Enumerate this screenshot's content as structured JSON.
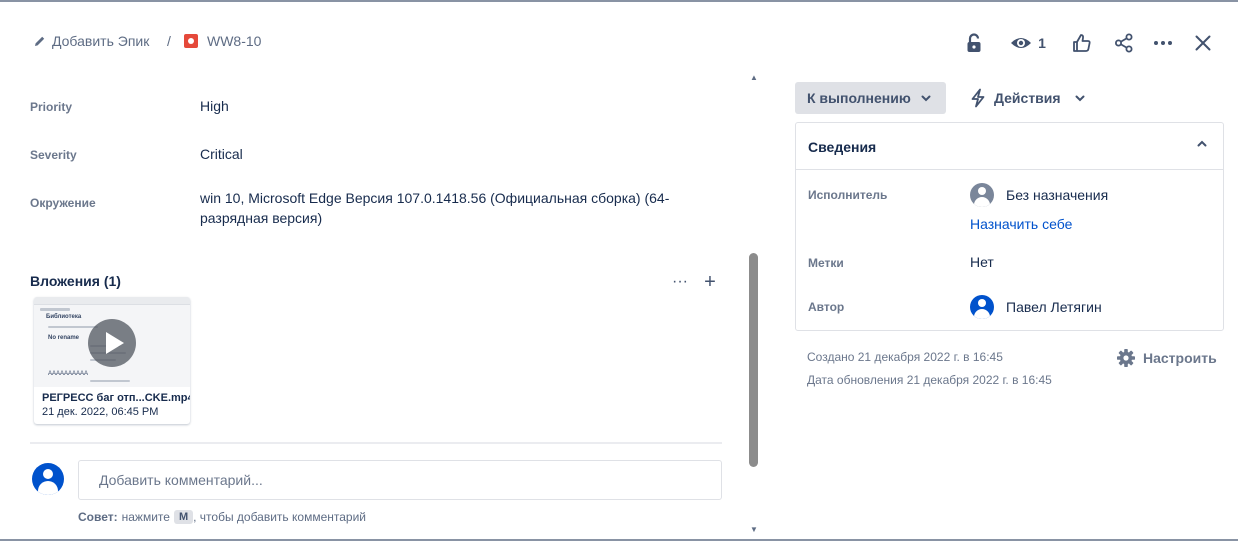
{
  "header": {
    "add_epic": "Добавить Эпик",
    "separator": "/",
    "issue_key": "WW8-10",
    "watch_count": "1"
  },
  "fields": [
    {
      "label": "Priority",
      "value": "High"
    },
    {
      "label": "Severity",
      "value": "Critical"
    },
    {
      "label": "Окружение",
      "value_line1": "win 10, Microsoft Edge Версия 107.0.1418.56 (Официальная сборка) (64-",
      "value_line2": "разрядная версия)"
    }
  ],
  "attachments": {
    "title": "Вложения (1)",
    "more": "···",
    "add": "+",
    "items": [
      {
        "name": "РЕГРЕСС баг отп...CKE.mp4",
        "date": "21 дек. 2022, 06:45 PM",
        "thumb_title": "Библиотека",
        "thumb_row": "No rename",
        "thumb_text": "АААААААААА"
      }
    ]
  },
  "comment": {
    "placeholder": "Добавить комментарий...",
    "tip_prefix": "Совет:",
    "tip_mid": "нажмите",
    "tip_key": "M",
    "tip_suffix": ", чтобы добавить комментарий"
  },
  "sidebar": {
    "status": "К выполнению",
    "actions": "Действия",
    "details": {
      "title": "Сведения",
      "assignee_label": "Исполнитель",
      "assignee_value": "Без назначения",
      "assign_to_me": "Назначить себе",
      "labels_label": "Метки",
      "labels_value": "Нет",
      "reporter_label": "Автор",
      "reporter_value": "Павел Летягин"
    },
    "created": "Создано 21 декабря 2022 г. в 16:45",
    "updated": "Дата обновления 21 декабря 2022 г. в 16:45",
    "configure": "Настроить"
  },
  "colors": {
    "accent": "#0052cc",
    "bug": "#e5493a",
    "status_bg": "#dfe1e6"
  }
}
